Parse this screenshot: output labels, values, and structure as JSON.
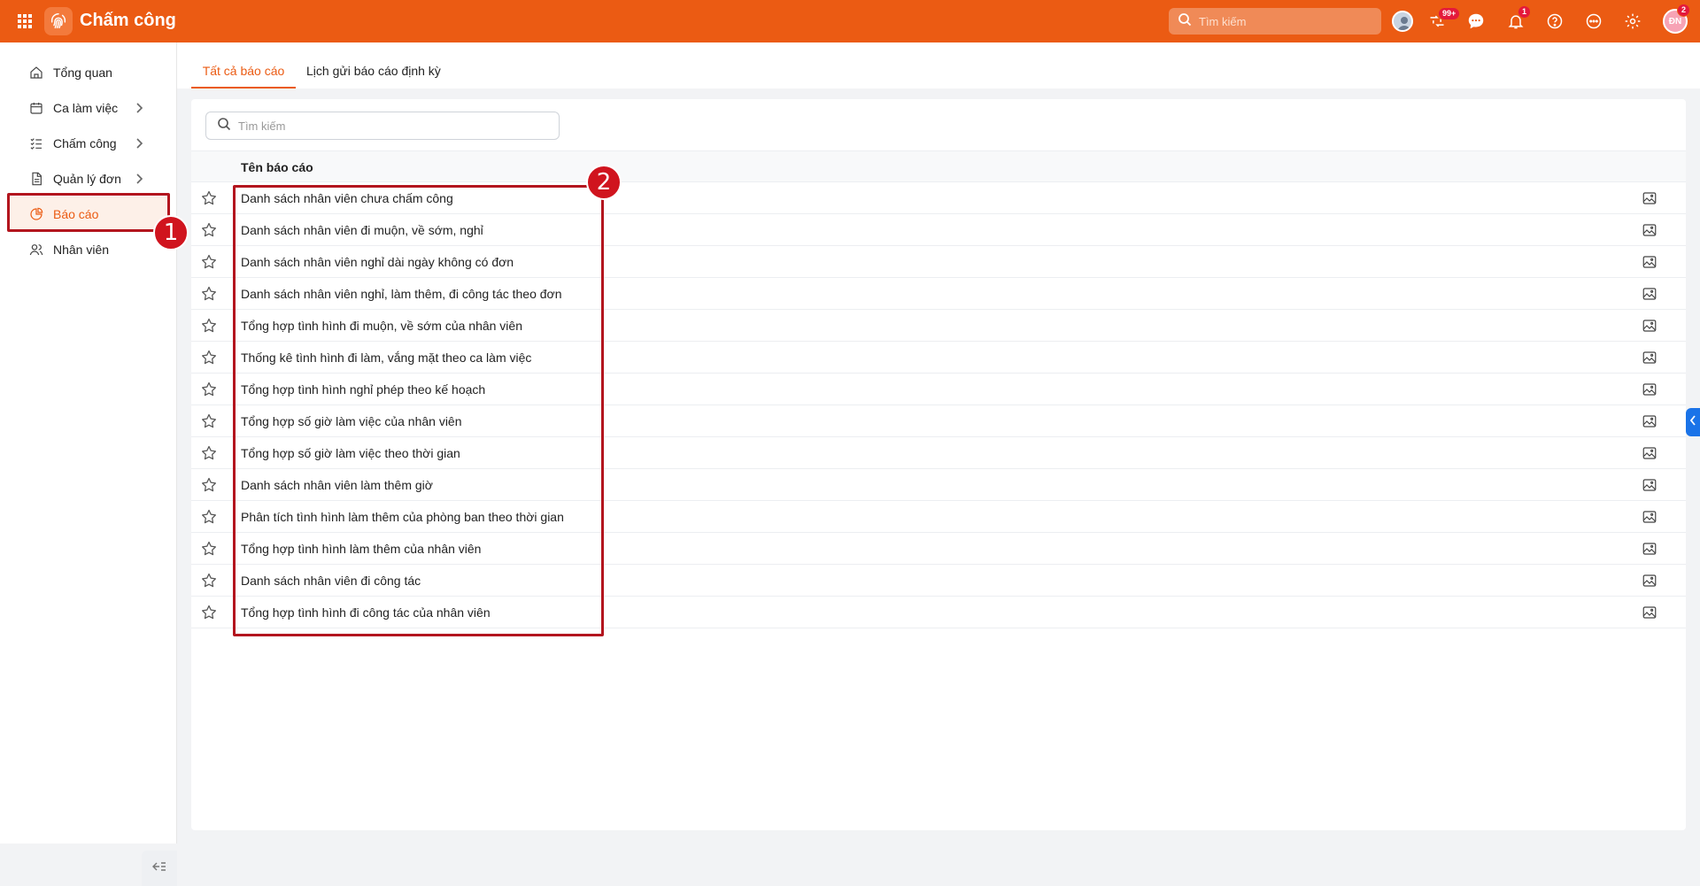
{
  "app": {
    "title": "Chấm công",
    "search_placeholder": "Tìm kiếm",
    "user_initials": "ĐN",
    "badges": {
      "approvals": "99+",
      "notifications": "1",
      "user": "2"
    },
    "brand_color": "#eb5b13"
  },
  "sidebar": {
    "items": [
      {
        "label": "Tổng quan",
        "icon": "home-icon"
      },
      {
        "label": "Ca làm việc",
        "icon": "calendar-icon"
      },
      {
        "label": "Chấm công",
        "icon": "checklist-icon"
      },
      {
        "label": "Quản lý đơn",
        "icon": "document-icon"
      },
      {
        "label": "Báo cáo",
        "icon": "pie-chart-icon"
      },
      {
        "label": "Nhân viên",
        "icon": "users-icon"
      }
    ],
    "active_item": "Báo cáo"
  },
  "tabs": [
    {
      "label": "Tất cả báo cáo"
    },
    {
      "label": "Lịch gửi báo cáo định kỳ"
    }
  ],
  "report_search": {
    "placeholder": "Tìm kiếm"
  },
  "table": {
    "header": "Tên báo cáo",
    "rows": [
      "Danh sách nhân viên chưa chấm công",
      "Danh sách nhân viên đi muộn, về sớm, nghỉ",
      "Danh sách nhân viên nghỉ dài ngày không có đơn",
      "Danh sách nhân viên nghỉ, làm thêm, đi công tác theo đơn",
      "Tổng hợp tình hình đi muộn, về sớm của nhân viên",
      "Thống kê tình hình đi làm, vắng mặt theo ca làm việc",
      "Tổng hợp tình hình nghỉ phép theo kế hoạch",
      "Tổng hợp số giờ làm việc của nhân viên",
      "Tổng hợp số giờ làm việc theo thời gian",
      "Danh sách nhân viên làm thêm giờ",
      "Phân tích tình hình làm thêm của phòng ban theo thời gian",
      "Tổng hợp tình hình làm thêm của nhân viên",
      "Danh sách nhân viên đi công tác",
      "Tổng hợp tình hình đi công tác của nhân viên"
    ]
  },
  "annotations": {
    "marker_1": "1",
    "marker_2": "2"
  }
}
